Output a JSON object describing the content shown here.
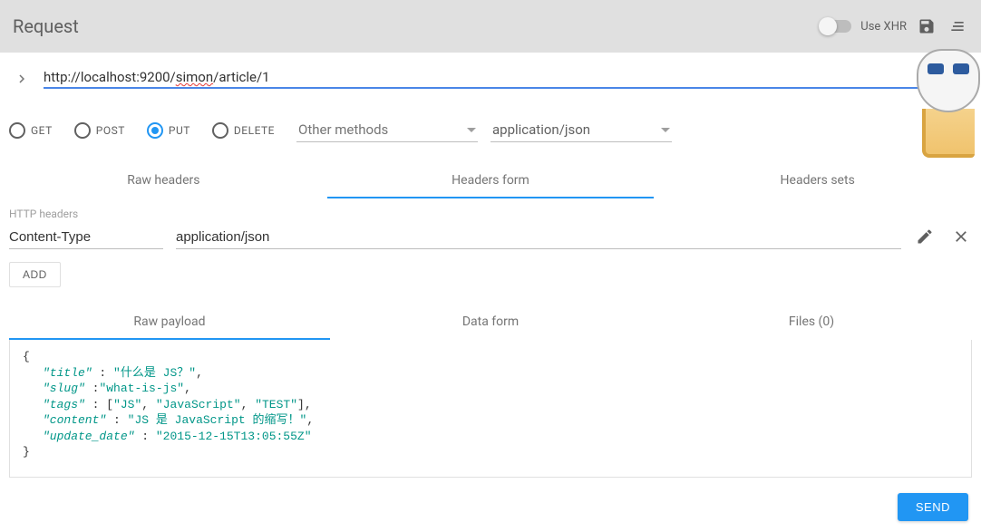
{
  "topbar": {
    "title": "Request",
    "use_xhr_label": "Use XHR",
    "use_xhr_on": false
  },
  "url": {
    "value": "http://localhost:9200/simon/article/1",
    "parts": {
      "pre": "http://localhost:9200/",
      "misspelled": "simon",
      "post": "/article/1"
    }
  },
  "methods": {
    "options": [
      "GET",
      "POST",
      "PUT",
      "DELETE"
    ],
    "selected": "PUT",
    "other_placeholder": "Other methods",
    "content_type": "application/json"
  },
  "header_tabs": {
    "items": [
      "Raw headers",
      "Headers form",
      "Headers sets"
    ],
    "active": "Headers form"
  },
  "headers_section": {
    "label": "HTTP headers",
    "rows": [
      {
        "name": "Content-Type",
        "value": "application/json"
      }
    ],
    "add_label": "ADD"
  },
  "payload_tabs": {
    "items": [
      "Raw payload",
      "Data form",
      "Files (0)"
    ],
    "active": "Raw payload"
  },
  "payload": {
    "raw": "{\n    \"title\" : \"什么是 JS？\",\n    \"slug\" :\"what-is-js\",\n    \"tags\" : [\"JS\", \"JavaScript\", \"TEST\"],\n    \"content\" : \"JS 是 JavaScript 的缩写！\",\n    \"update_date\" : \"2015-12-15T13:05:55Z\"\n}",
    "json": {
      "title": "什么是 JS？",
      "slug": "what-is-js",
      "tags": [
        "JS",
        "JavaScript",
        "TEST"
      ],
      "content": "JS 是 JavaScript 的缩写！",
      "update_date": "2015-12-15T13:05:55Z"
    }
  },
  "send_label": "SEND"
}
